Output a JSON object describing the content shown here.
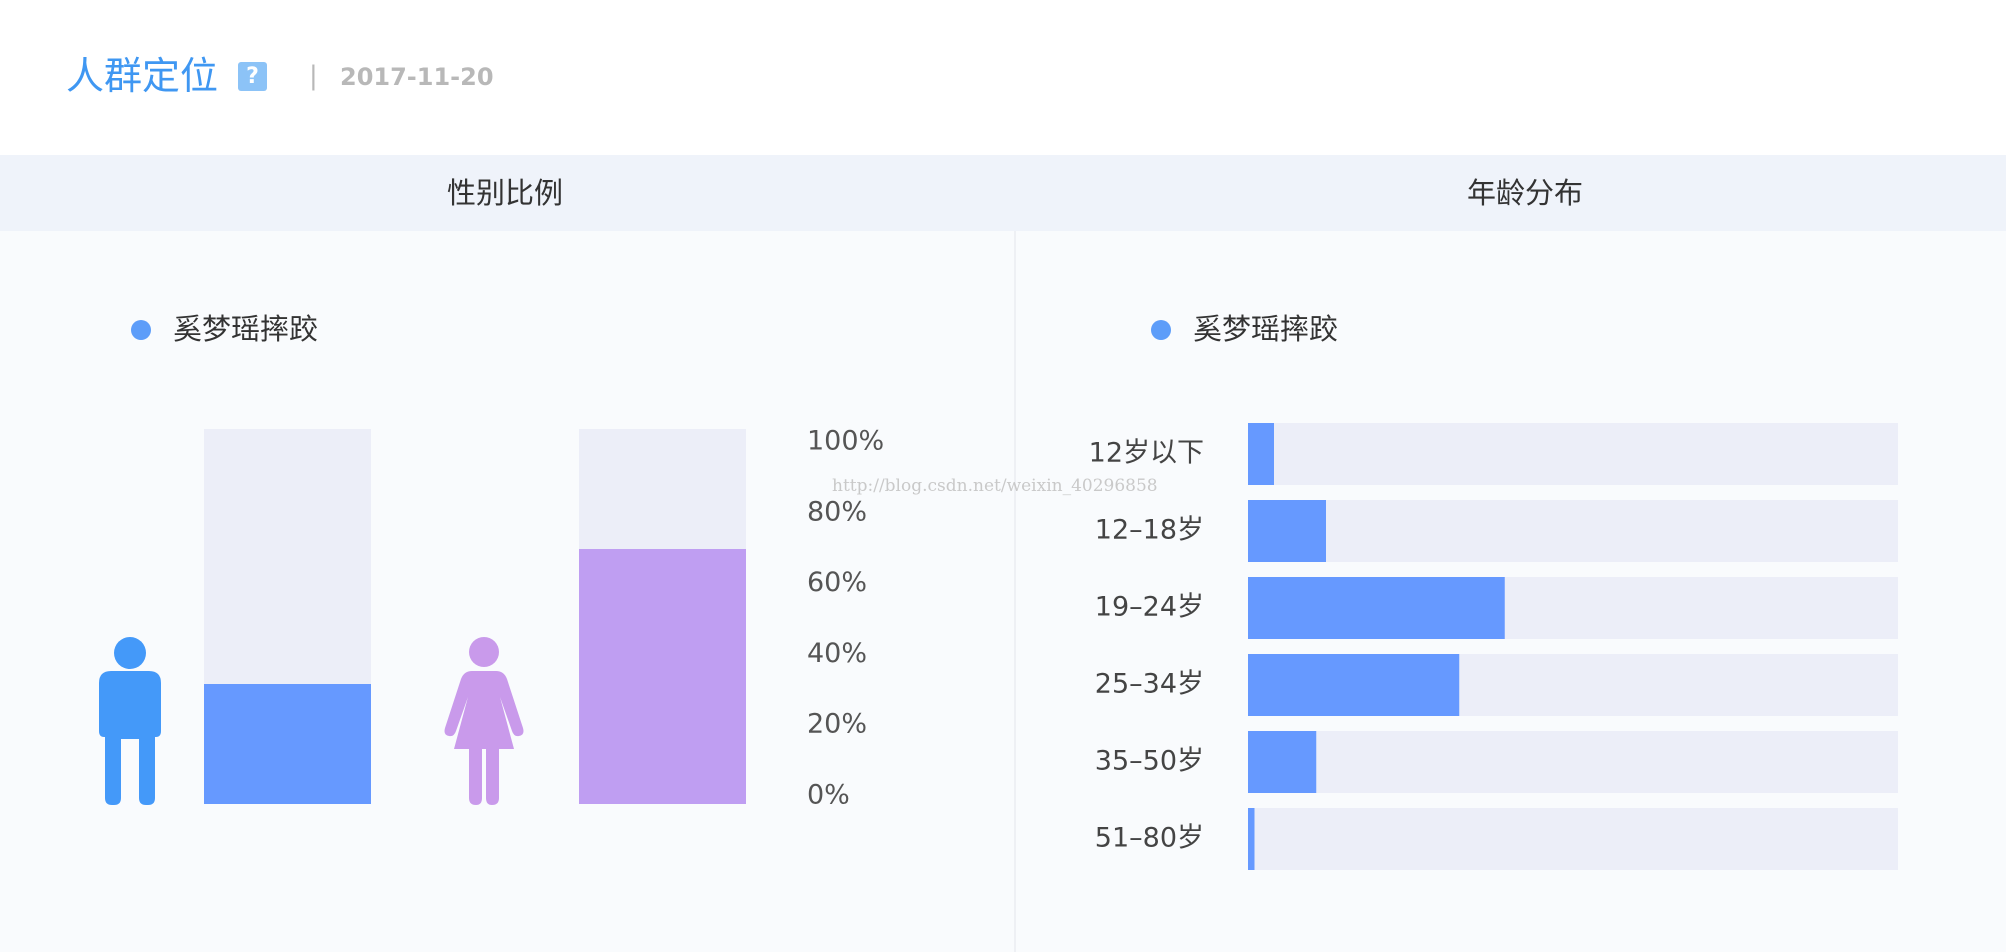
{
  "header": {
    "title": "人群定位",
    "help_icon": "?",
    "separator": "|",
    "date": "2017-11-20"
  },
  "panels": {
    "gender_title": "性别比例",
    "age_title": "年龄分布"
  },
  "colors": {
    "accent": "#3f97f2",
    "male": "#6699ff",
    "female": "#bf9ef2",
    "track": "#eceef8",
    "male_icon": "#4499f9",
    "female_icon": "#c99aeb"
  },
  "watermark": "http://blog.csdn.net/weixin_40296858",
  "chart_data": [
    {
      "type": "bar",
      "legend": "奚梦瑶摔跤",
      "icons": [
        "male-icon",
        "female-icon"
      ],
      "values": [
        32,
        68
      ],
      "ylim": [
        0,
        100
      ],
      "y_ticks": [
        "100%",
        "80%",
        "60%",
        "40%",
        "20%",
        "0%"
      ],
      "grid": false
    },
    {
      "type": "bar",
      "orientation": "horizontal",
      "legend": "奚梦瑶摔跤",
      "categories": [
        "12岁以下",
        "12–18岁",
        "19–24岁",
        "25–34岁",
        "35–50岁",
        "51–80岁"
      ],
      "values": [
        4,
        12,
        39.5,
        32.5,
        10.5,
        1
      ],
      "xlim": [
        0,
        100
      ],
      "grid": false
    }
  ]
}
